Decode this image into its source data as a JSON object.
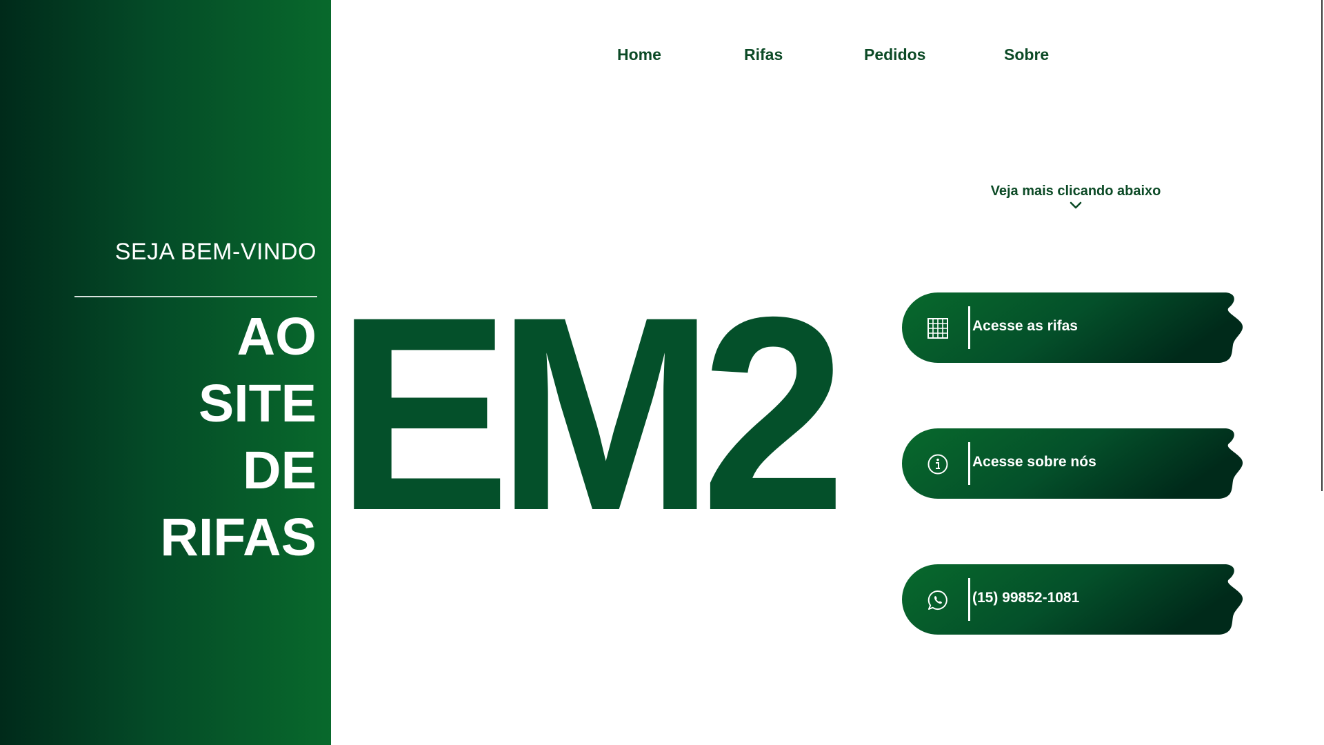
{
  "side_panel": {
    "welcome": "SEJA BEM-VINDO",
    "headline_lines": [
      "AO",
      "SITE",
      "DE",
      "RIFAS"
    ]
  },
  "logo": {
    "text": "EM2",
    "color": "#04502a"
  },
  "nav": {
    "items": [
      {
        "label": "Home"
      },
      {
        "label": "Rifas"
      },
      {
        "label": "Pedidos"
      },
      {
        "label": "Sobre"
      }
    ]
  },
  "hint": {
    "text": "Veja mais clicando abaixo",
    "icon": "chevron-down-icon"
  },
  "actions": [
    {
      "label": "Acesse as rifas",
      "icon": "grid-icon"
    },
    {
      "label": "Acesse sobre nós",
      "icon": "info-icon"
    },
    {
      "label": "(15) 99852-1081",
      "icon": "whatsapp-icon"
    }
  ],
  "colors": {
    "brand_green": "#04502a",
    "dark_green": "#002a1a",
    "text_green": "#0c4a26"
  }
}
